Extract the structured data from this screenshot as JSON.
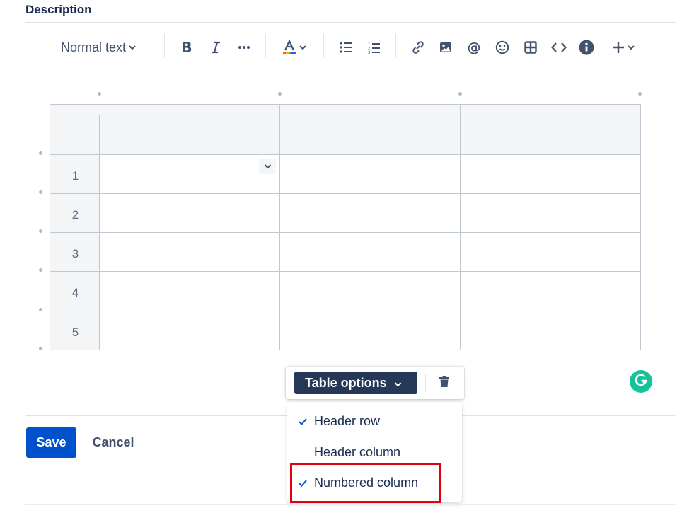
{
  "field": {
    "label": "Description"
  },
  "toolbar": {
    "text_style": "Normal text",
    "icons": [
      "chevron-down-icon",
      "bold-icon",
      "italic-icon",
      "more-icon",
      "text-color-icon",
      "bullet-list-icon",
      "numbered-list-icon",
      "link-icon",
      "image-icon",
      "mention-icon",
      "emoji-icon",
      "table-icon",
      "code-icon",
      "info-icon",
      "plus-icon"
    ],
    "text_color_swatch": [
      "#ff5630",
      "#ffab00",
      "#36b37e",
      "#0065ff",
      "#6554c0"
    ]
  },
  "table": {
    "row_numbers": [
      "1",
      "2",
      "3",
      "4",
      "5"
    ],
    "columns": 3,
    "header_row": true,
    "numbered_column": true
  },
  "table_toolbar": {
    "options_label": "Table options"
  },
  "table_options_menu": {
    "items": [
      {
        "label": "Header row",
        "checked": true
      },
      {
        "label": "Header column",
        "checked": false
      },
      {
        "label": "Numbered column",
        "checked": true
      }
    ]
  },
  "actions": {
    "save_label": "Save",
    "cancel_label": "Cancel"
  },
  "colors": {
    "primary": "#0052cc",
    "toolbar_dark": "#253858",
    "highlight": "#e3000f",
    "grammarly": "#15c39a"
  }
}
